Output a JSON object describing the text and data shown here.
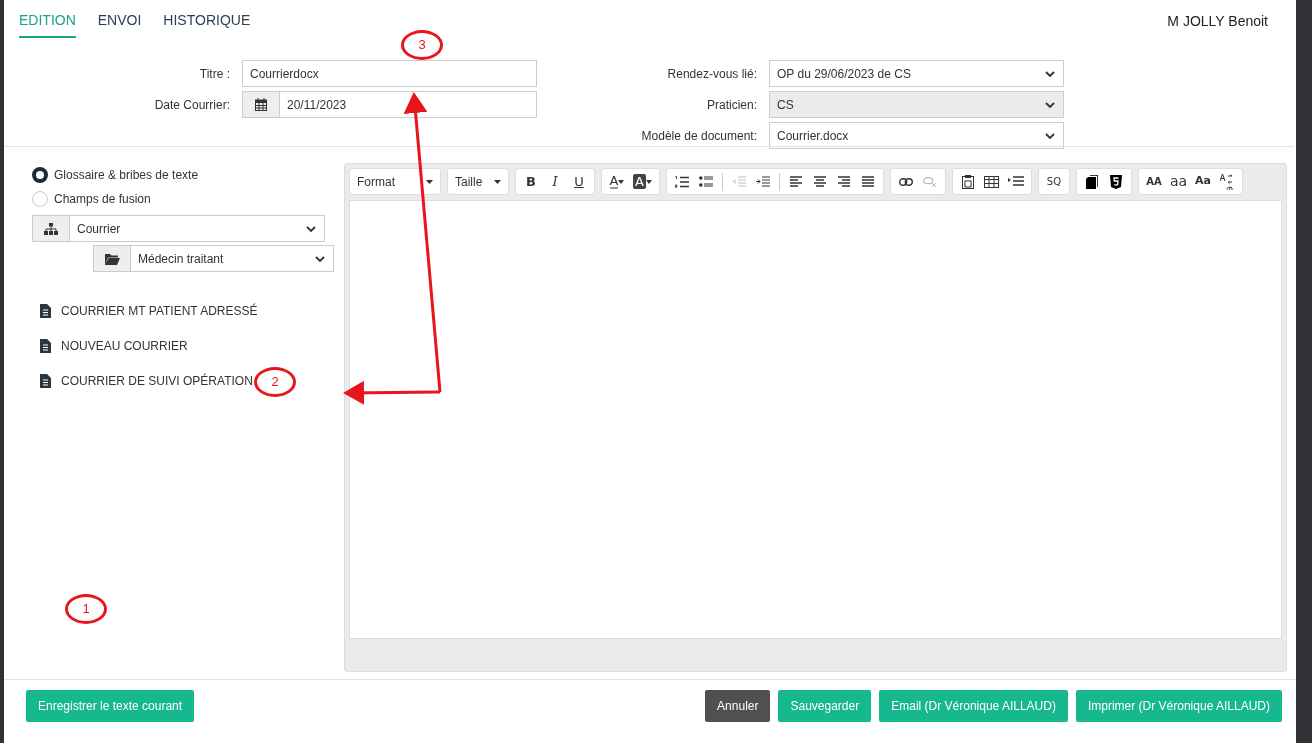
{
  "tabs": [
    {
      "label": "EDITION",
      "selected": true
    },
    {
      "label": "ENVOI",
      "selected": false
    },
    {
      "label": "HISTORIQUE",
      "selected": false
    }
  ],
  "user": "M JOLLY Benoit",
  "form_left": [
    {
      "label": "Titre :",
      "value": "Courrierdocx",
      "kind": "text"
    },
    {
      "label": "Date Courrier:",
      "value": "20/11/2023",
      "kind": "date"
    }
  ],
  "form_right": [
    {
      "label": "Rendez-vous lié:",
      "value": "OP du 29/06/2023 de CS",
      "disabled": false
    },
    {
      "label": "Praticien:",
      "value": "CS",
      "disabled": true
    },
    {
      "label": "Modèle de document:",
      "value": "Courrier.docx",
      "disabled": false
    }
  ],
  "source_options": [
    {
      "label": "Glossaire & bribes de texte",
      "selected": true
    },
    {
      "label": "Champs de fusion",
      "selected": false
    }
  ],
  "category": "Courrier",
  "subcategory": "Médecin traitant",
  "documents": [
    "COURRIER MT PATIENT ADRESSÉ",
    "NOUVEAU COURRIER",
    "COURRIER DE SUIVI OPÉRATION"
  ],
  "toolbar": {
    "format": "Format",
    "size": "Taille",
    "bold": "B",
    "italic": "I",
    "underline": "U",
    "font_color": "A",
    "background_color": "A",
    "source": "SQ",
    "uppercase": "AA",
    "lowercase": "aa",
    "capitalize": "Aa"
  },
  "footer_left": "Enregistrer le texte courant",
  "footer_buttons": [
    {
      "label": "Annuler",
      "kind": "secondary"
    },
    {
      "label": "Sauvegarder",
      "kind": "primary"
    },
    {
      "label": "Email (Dr Véronique AILLAUD)",
      "kind": "primary"
    },
    {
      "label": "Imprimer (Dr Véronique AILLAUD)",
      "kind": "primary"
    }
  ],
  "annotations": [
    {
      "label": "1"
    },
    {
      "label": "2"
    },
    {
      "label": "3"
    }
  ]
}
